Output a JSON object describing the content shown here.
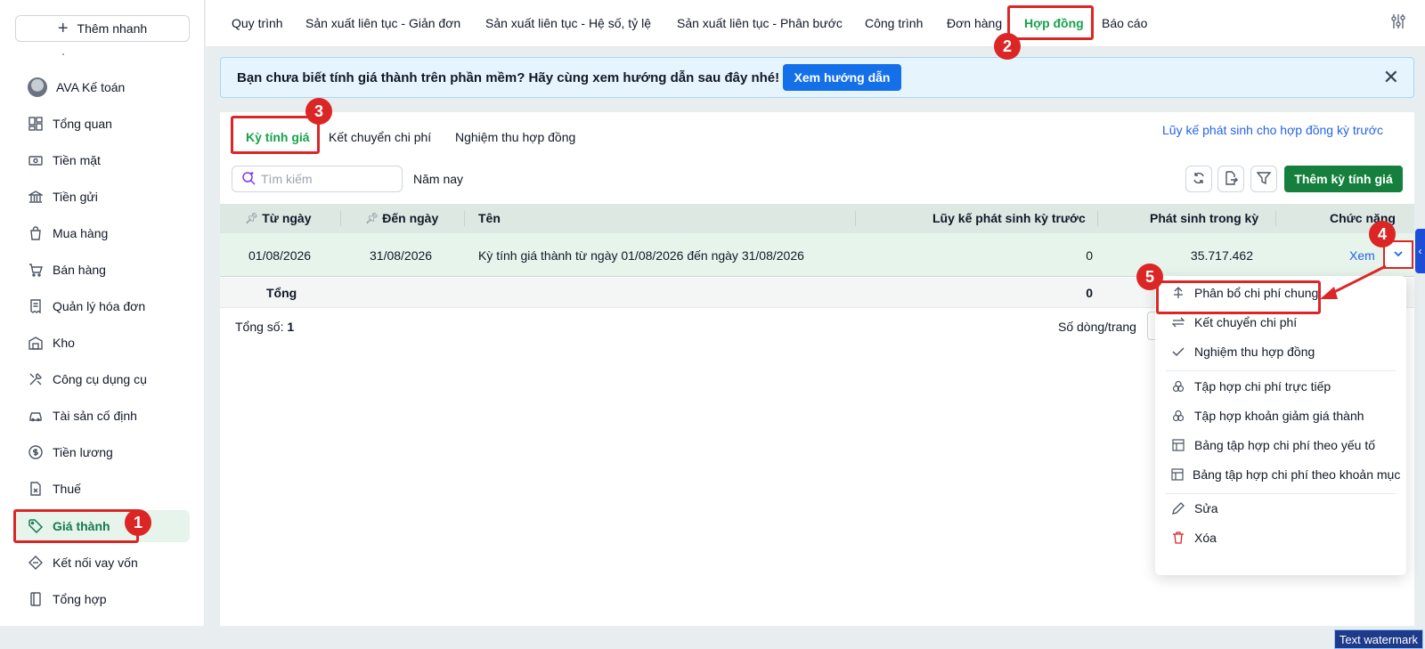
{
  "sidebar": {
    "quick_add": "Thêm nhanh",
    "user": "AVA Kế toán",
    "items": [
      {
        "label": "Tổng quan",
        "icon": "dashboard-icon"
      },
      {
        "label": "Tiền mặt",
        "icon": "cash-icon"
      },
      {
        "label": "Tiền gửi",
        "icon": "bank-icon"
      },
      {
        "label": "Mua hàng",
        "icon": "shopping-bag-icon"
      },
      {
        "label": "Bán hàng",
        "icon": "cart-icon"
      },
      {
        "label": "Quản lý hóa đơn",
        "icon": "invoice-icon"
      },
      {
        "label": "Kho",
        "icon": "warehouse-icon"
      },
      {
        "label": "Công cụ dụng cụ",
        "icon": "tools-icon"
      },
      {
        "label": "Tài sản cố định",
        "icon": "car-icon"
      },
      {
        "label": "Tiền lương",
        "icon": "dollar-circle-icon"
      },
      {
        "label": "Thuế",
        "icon": "tax-document-icon"
      },
      {
        "label": "Giá thành",
        "icon": "tag-icon",
        "active": true
      },
      {
        "label": "Kết nối vay vốn",
        "icon": "connect-icon"
      },
      {
        "label": "Tổng hợp",
        "icon": "book-icon"
      }
    ]
  },
  "top_tabs": [
    "Quy trình",
    "Sản xuất liên tục - Giản đơn",
    "Sản xuất liên tục - Hệ số, tỷ lệ",
    "Sản xuất liên tục - Phân bước",
    "Công trình",
    "Đơn hàng",
    "Hợp đồng",
    "Báo cáo"
  ],
  "banner": {
    "text": "Bạn chưa biết tính giá thành trên phần mềm? Hãy cùng xem hướng dẫn sau đây nhé!",
    "button": "Xem hướng dẫn"
  },
  "sub_tabs": [
    "Kỳ tính giá",
    "Kết chuyển chi phí",
    "Nghiệm thu hợp đồng"
  ],
  "cumulative_link": "Lũy kế phát sinh cho hợp đồng kỳ trước",
  "toolbar": {
    "search_placeholder": "Tìm kiếm",
    "year_filter": "Năm nay",
    "add_button": "Thêm kỳ tính giá"
  },
  "table": {
    "headers": [
      "Từ ngày",
      "Đến ngày",
      "Tên",
      "Lũy kế phát sinh kỳ trước",
      "Phát sinh trong kỳ",
      "Chức năng"
    ],
    "rows": [
      {
        "from": "01/08/2026",
        "to": "31/08/2026",
        "name": "Kỳ tính giá thành từ ngày 01/08/2026 đến ngày 31/08/2026",
        "prev": "0",
        "current": "35.717.462",
        "action": "Xem"
      }
    ],
    "footer": {
      "label": "Tổng",
      "prev": "0"
    },
    "total_label": "Tổng số:",
    "total_value": "1",
    "page_size_label": "Số dòng/trang"
  },
  "menu": [
    {
      "label": "Phân bổ chi phí chung",
      "icon": "distribute-icon"
    },
    {
      "label": "Kết chuyển chi phí",
      "icon": "transfer-arrows-icon"
    },
    {
      "label": "Nghiệm thu hợp đồng",
      "icon": "check-icon"
    },
    {
      "label": "Tập hợp chi phí trực tiếp",
      "icon": "circles-icon"
    },
    {
      "label": "Tập hợp khoản giảm giá thành",
      "icon": "circles-icon"
    },
    {
      "label": "Bảng tập hợp chi phí theo yếu tố",
      "icon": "table-icon"
    },
    {
      "label": "Bảng tập hợp chi phí theo khoản mục",
      "icon": "table-icon"
    },
    {
      "label": "Sửa",
      "icon": "pencil-icon"
    },
    {
      "label": "Xóa",
      "icon": "trash-icon"
    }
  ],
  "annotations": [
    "1",
    "2",
    "3",
    "4",
    "5"
  ],
  "watermark": "Text watermark",
  "colors": {
    "accent_green": "#16a34a",
    "primary_blue": "#1470e8",
    "highlight_red": "#dc2626"
  }
}
